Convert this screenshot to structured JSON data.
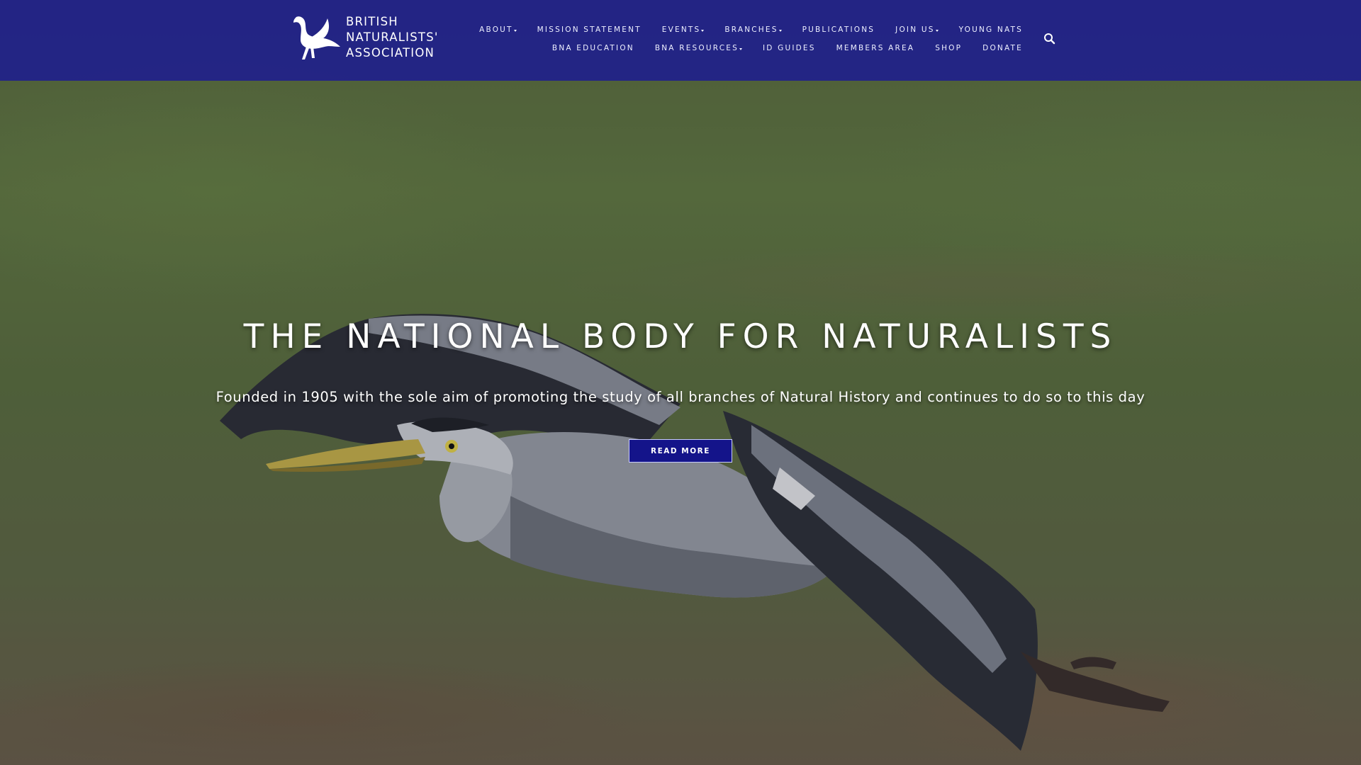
{
  "site": {
    "logo_lines": [
      "BRITISH",
      "NATURALISTS'",
      "ASSOCIATION"
    ]
  },
  "nav": {
    "row1": [
      {
        "label": "ABOUT",
        "dropdown": true
      },
      {
        "label": "MISSION STATEMENT",
        "dropdown": false
      },
      {
        "label": "EVENTS",
        "dropdown": true
      },
      {
        "label": "BRANCHES",
        "dropdown": true
      },
      {
        "label": "PUBLICATIONS",
        "dropdown": false
      },
      {
        "label": "JOIN US",
        "dropdown": true
      },
      {
        "label": "YOUNG NATS",
        "dropdown": false
      }
    ],
    "row2": [
      {
        "label": "BNA EDUCATION",
        "dropdown": false
      },
      {
        "label": "BNA RESOURCES",
        "dropdown": true
      },
      {
        "label": "ID GUIDES",
        "dropdown": false
      },
      {
        "label": "MEMBERS AREA",
        "dropdown": false
      },
      {
        "label": "SHOP",
        "dropdown": false
      },
      {
        "label": "DONATE",
        "dropdown": false
      }
    ],
    "search_icon": "search-icon"
  },
  "hero": {
    "title": "THE NATIONAL BODY FOR NATURALISTS",
    "subtitle": "Founded in 1905 with the sole aim of promoting the study of all branches of Natural History and continues to do so to this day",
    "button_label": "READ MORE",
    "image": "heron-in-flight"
  },
  "colors": {
    "header_bg": "#20208a",
    "button_bg": "#14148a"
  }
}
